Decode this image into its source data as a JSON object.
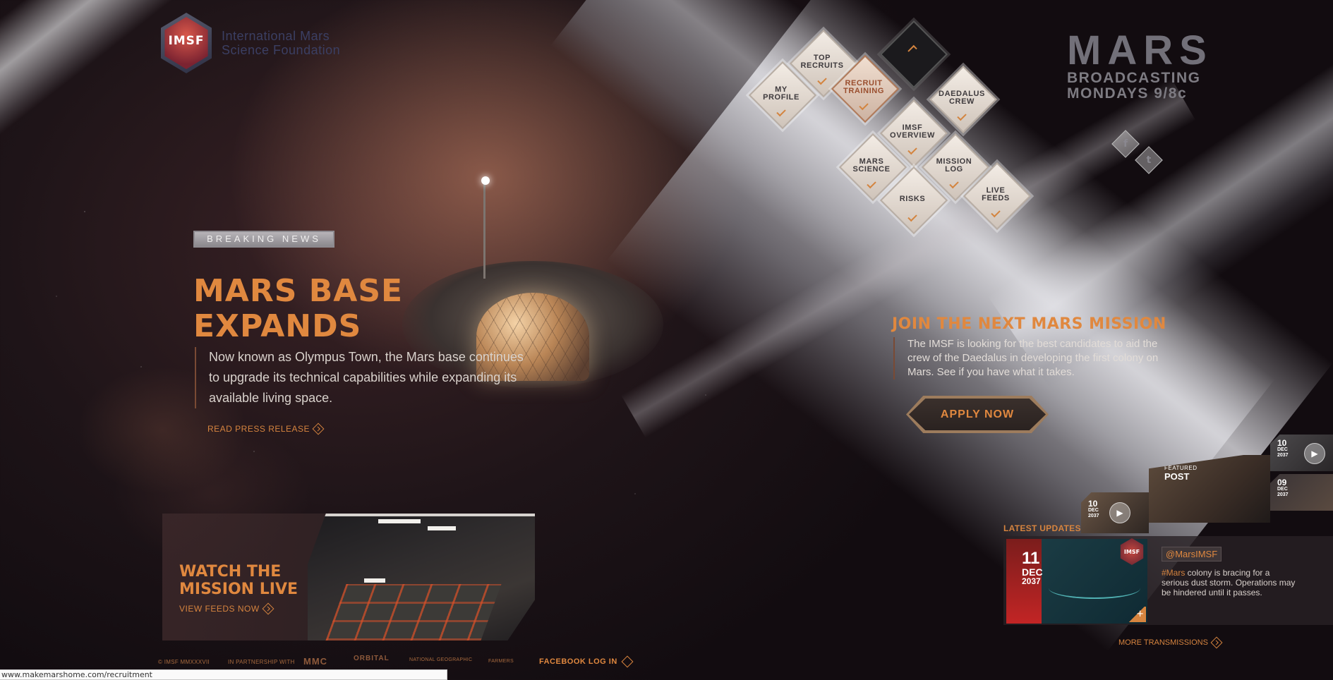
{
  "logo": {
    "badge_text": "IMSF",
    "name_line1": "International Mars",
    "name_line2": "Science Foundation"
  },
  "nav": {
    "up_label": "",
    "items": [
      {
        "key": "top_recruits",
        "line1": "TOP",
        "line2": "RECRUITS"
      },
      {
        "key": "my_profile",
        "line1": "MY",
        "line2": "PROFILE"
      },
      {
        "key": "recruit_training",
        "line1": "RECRUIT",
        "line2": "TRAINING"
      },
      {
        "key": "daedalus_crew",
        "line1": "DAEDALUS",
        "line2": "CREW"
      },
      {
        "key": "imsf_overview",
        "line1": "IMSF",
        "line2": "OVERVIEW"
      },
      {
        "key": "mars_science",
        "line1": "MARS",
        "line2": "SCIENCE"
      },
      {
        "key": "mission_log",
        "line1": "MISSION",
        "line2": "LOG"
      },
      {
        "key": "risks",
        "line1": "RISKS",
        "line2": ""
      },
      {
        "key": "live_feeds",
        "line1": "LIVE",
        "line2": "FEEDS"
      }
    ]
  },
  "broadcast": {
    "title": "MARS",
    "line1": "BROADCASTING",
    "line2": "MONDAYS 9/8c"
  },
  "social": {
    "facebook": "f",
    "twitter": "t"
  },
  "hero": {
    "badge": "BREAKING NEWS",
    "headline_line1": "MARS BASE",
    "headline_line2": "EXPANDS",
    "body": "Now known as Olympus Town, the Mars base continues to upgrade its technical capabilities while expanding its available living space.",
    "link": "READ PRESS RELEASE"
  },
  "join": {
    "title": "JOIN THE NEXT MARS MISSION",
    "body": "The IMSF is looking for the best candidates to aid the crew of the Daedalus in developing the first colony on Mars. See if you have what it takes.",
    "button": "APPLY NOW"
  },
  "watch": {
    "title_line1": "WATCH THE",
    "title_line2": "MISSION LIVE",
    "link": "VIEW FEEDS NOW"
  },
  "updates": {
    "label": "LATEST UPDATES",
    "main": {
      "day": "11",
      "month": "DEC",
      "year": "2037",
      "handle": "@MarsIMSF",
      "tag": "#Mars",
      "text": " colony is bracing for a serious dust storm. Operations may be hindered until it passes.",
      "badge": "IMSF"
    },
    "featured": {
      "small": "FEATURED",
      "big": "POST"
    },
    "thumbs": [
      {
        "day": "10",
        "month": "DEC",
        "year": "2037"
      },
      {
        "day": "10",
        "month": "DEC",
        "year": "2037"
      },
      {
        "day": "09",
        "month": "DEC",
        "year": "2037"
      }
    ],
    "more": "MORE TRANSMISSIONS"
  },
  "footer": {
    "copyright": "© IMSF MMXXXVII",
    "partnership": "IN PARTNERSHIP WITH",
    "partners": [
      "MMC",
      "ORBITAL",
      "NATIONAL GEOGRAPHIC",
      "FARMERS"
    ],
    "facebook_login": "FACEBOOK LOG IN"
  },
  "status_bar": {
    "url": "www.makemarshome.com/recruitment"
  }
}
